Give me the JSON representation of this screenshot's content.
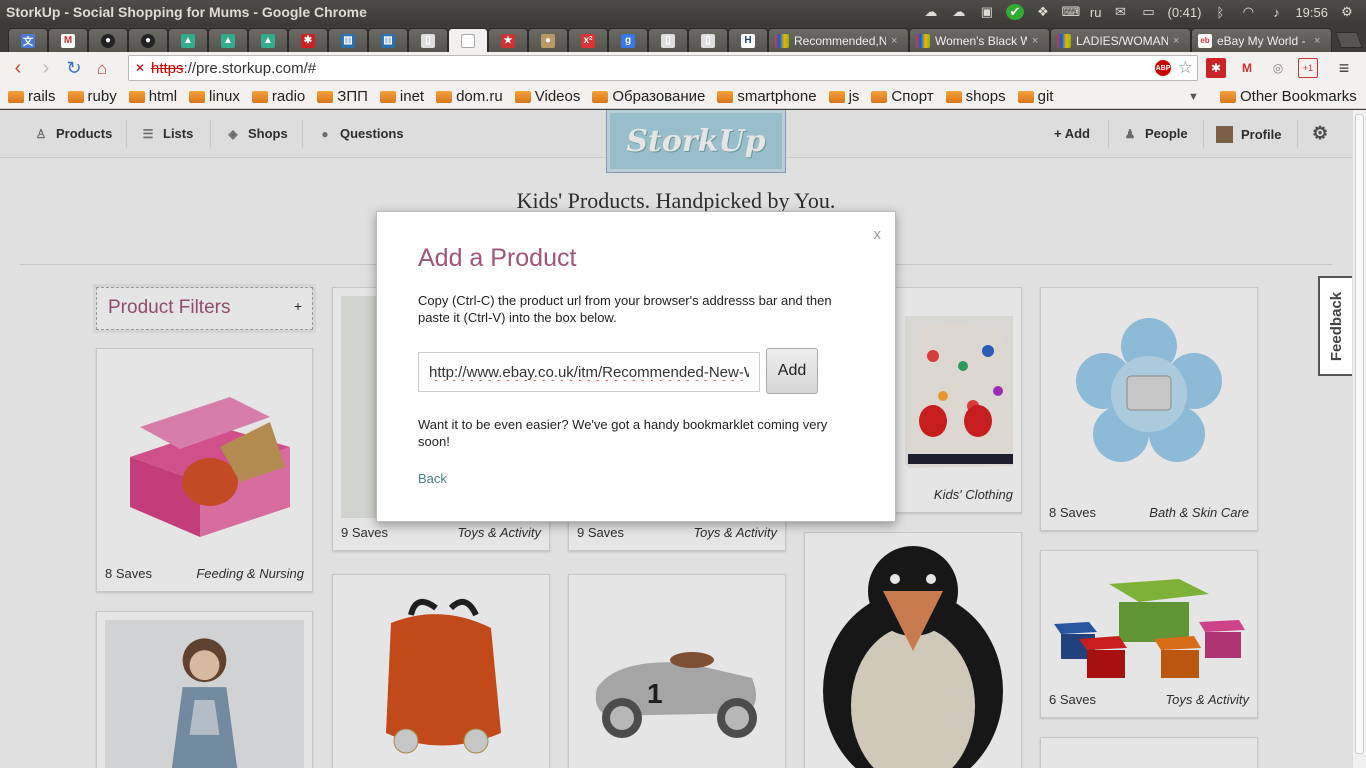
{
  "os": {
    "window_title": "StorkUp - Social Shopping for Mums - Google Chrome",
    "language": "ru",
    "battery": "(0:41)",
    "clock": "19:56"
  },
  "tabs": [
    {
      "label": "Recommended,N",
      "close": "×"
    },
    {
      "label": "Women's Black W",
      "close": "×"
    },
    {
      "label": "LADIES/WOMAN",
      "close": "×"
    },
    {
      "label": "eBay My World -",
      "close": "×"
    }
  ],
  "omnibox": {
    "scheme": "https",
    "rest": "://pre.storkup.com/#"
  },
  "bookmarks": [
    "rails",
    "ruby",
    "html",
    "linux",
    "radio",
    "ЗПП",
    "inet",
    "dom.ru",
    "Videos",
    "Образование",
    "smartphone",
    "js",
    "Спорт",
    "shops",
    "git"
  ],
  "other_bookmarks": "Other Bookmarks",
  "site": {
    "nav": {
      "products": "Products",
      "lists": "Lists",
      "shops": "Shops",
      "questions": "Questions",
      "add": "+ Add",
      "people": "People",
      "profile": "Profile"
    },
    "logo": "StorkUp",
    "tagline": "Kids' Products. Handpicked by You.",
    "filters": {
      "label": "Product Filters",
      "toggle": "+"
    },
    "feedback": "Feedback",
    "cards": [
      {
        "saves": "8 Saves",
        "category": "Feeding & Nursing"
      },
      {
        "saves": "9 Saves",
        "category": "Toys & Activity"
      },
      {
        "saves": "9 Saves",
        "category": "Toys & Activity"
      },
      {
        "saves": "",
        "category": "Kids' Clothing"
      },
      {
        "saves": "8 Saves",
        "category": "Bath & Skin Care"
      },
      {
        "saves": "6 Saves",
        "category": "Toys & Activity"
      }
    ]
  },
  "modal": {
    "close": "x",
    "title": "Add a Product",
    "description": "Copy (Ctrl-C) the product url from your browser's addresss bar and then paste it (Ctrl-V) into the box below.",
    "url_value": "http://www.ebay.co.uk/itm/Recommended-New-Wo",
    "add_button": "Add",
    "bookmarklet_text": "Want it to be even easier? We've got a handy bookmarklet coming very soon!",
    "back": "Back"
  }
}
